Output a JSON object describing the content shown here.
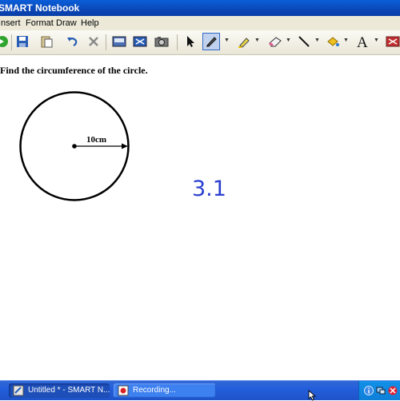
{
  "window": {
    "title": "SMART Notebook"
  },
  "menu": {
    "items": [
      "Insert",
      "Format",
      "Draw",
      "Help"
    ]
  },
  "toolbar": {
    "buttons": [
      "forward-icon",
      "save-icon",
      "paste-icon",
      "undo-icon",
      "delete-icon",
      "screen-shade-icon",
      "full-screen-icon",
      "capture-icon",
      "select-icon",
      "pen-icon",
      "highlighter-icon",
      "eraser-icon",
      "line-icon",
      "fill-icon",
      "text-icon"
    ]
  },
  "page": {
    "question": "Find the circumference of the circle.",
    "radius_label": "10cm",
    "handwritten_text": "3.1"
  },
  "taskbar": {
    "tasks": [
      {
        "label": "Untitled * - SMART N...",
        "state": "active"
      },
      {
        "label": "Recording...",
        "state": "inactive"
      }
    ]
  },
  "colors": {
    "titlebar": "#0b47b8",
    "menubar": "#ece9d8",
    "handwriting": "#2a3fd0",
    "taskbar": "#245edb"
  }
}
